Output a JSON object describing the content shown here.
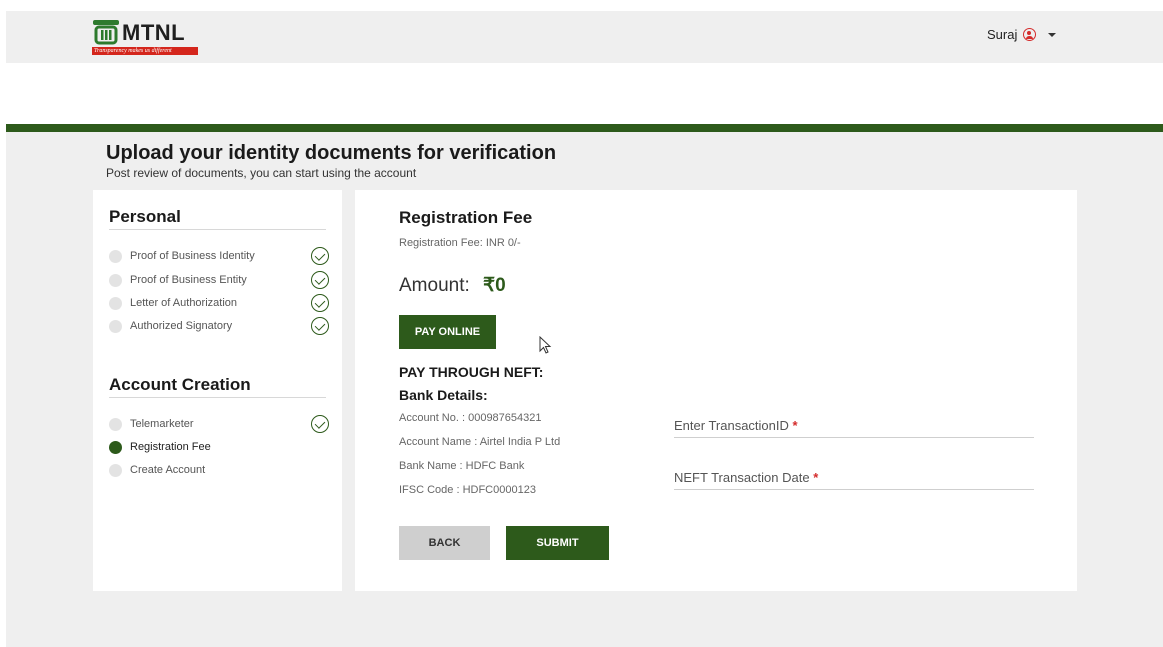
{
  "header": {
    "brand": "MTNL",
    "tagline": "Transparency makes us different",
    "user_name": "Suraj"
  },
  "page": {
    "title": "Upload your identity documents for verification",
    "subtitle": "Post review of documents, you can start using the account"
  },
  "sidebar": {
    "personal_title": "Personal",
    "personal_items": [
      {
        "label": "Proof of Business Identity",
        "done": true
      },
      {
        "label": "Proof of Business Entity",
        "done": true
      },
      {
        "label": "Letter of Authorization",
        "done": true
      },
      {
        "label": "Authorized Signatory",
        "done": true
      }
    ],
    "account_title": "Account Creation",
    "account_items": [
      {
        "label": "Telemarketer",
        "done": true
      },
      {
        "label": "Registration Fee",
        "active": true
      },
      {
        "label": "Create Account",
        "done": false
      }
    ]
  },
  "registration": {
    "title": "Registration Fee",
    "fee_text": "Registration Fee: INR 0/-",
    "amount_label": "Amount:",
    "amount_value": "₹0",
    "pay_online_label": "PAY ONLINE",
    "neft_title": "PAY THROUGH NEFT:",
    "bank_title": "Bank Details:",
    "bank_details": [
      "Account No. : 000987654321",
      "Account Name : Airtel India P Ltd",
      "Bank Name : HDFC Bank",
      "IFSC Code : HDFC0000123"
    ],
    "transaction_id_label": "Enter TransactionID",
    "transaction_date_label": "NEFT Transaction Date",
    "required_mark": "*",
    "back_label": "BACK",
    "submit_label": "SUBMIT"
  },
  "colors": {
    "brand_green": "#2d5a1b",
    "required_red": "#d42b2b",
    "logo_red": "#d4261c"
  }
}
